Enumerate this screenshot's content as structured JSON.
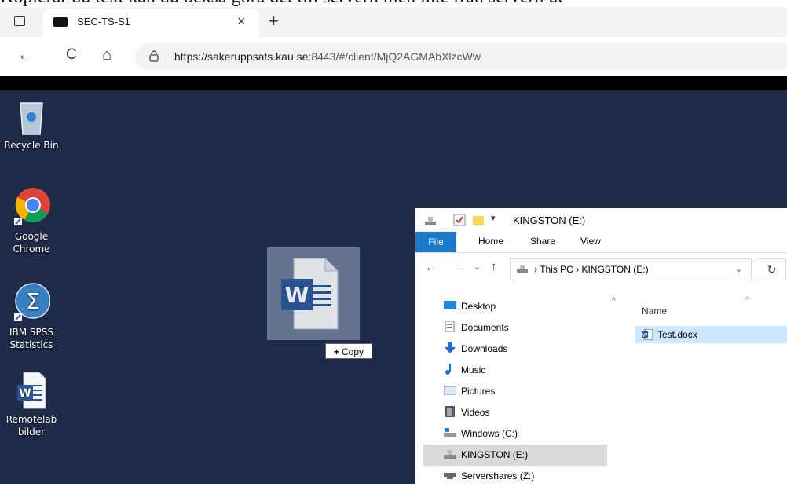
{
  "document_text": "Kopierar du text kan du också göra det till servern men inte från servern ut",
  "browser": {
    "tab_title": "SEC-TS-S1",
    "tab_close": "×",
    "new_tab": "+",
    "url_host": "https://sakeruppsats.kau.se",
    "url_rest": ":8443/#/client/MjQ2AGMAbXlzcWw",
    "back_icon": "←",
    "reload_icon": "C",
    "home_icon": "⌂"
  },
  "desktop": {
    "icons": [
      {
        "label_lines": [
          "Recycle Bin"
        ]
      },
      {
        "label_lines": [
          "Google",
          "Chrome"
        ]
      },
      {
        "label_lines": [
          "IBM SPSS",
          "Statistics"
        ]
      },
      {
        "label_lines": [
          "Remotelab",
          "bilder"
        ]
      }
    ],
    "drag_badge": "W",
    "copy_tooltip": "Copy",
    "copy_plus": "+"
  },
  "explorer": {
    "title": "KINGSTON (E:)",
    "ribbon_tabs": [
      "File",
      "Home",
      "Share",
      "View"
    ],
    "address_path": "This PC  ›  KINGSTON (E:)",
    "nav_items": [
      {
        "label": "Desktop",
        "icon": "desktop-icon"
      },
      {
        "label": "Documents",
        "icon": "documents-icon"
      },
      {
        "label": "Downloads",
        "icon": "downloads-icon"
      },
      {
        "label": "Music",
        "icon": "music-icon"
      },
      {
        "label": "Pictures",
        "icon": "pictures-icon"
      },
      {
        "label": "Videos",
        "icon": "videos-icon"
      },
      {
        "label": "Windows (C:)",
        "icon": "drive-icon"
      },
      {
        "label": "KINGSTON (E:)",
        "icon": "usb-drive-icon",
        "selected": true
      },
      {
        "label": "Servershares (Z:)",
        "icon": "network-drive-icon"
      }
    ],
    "column_header": "Name",
    "files": [
      {
        "name": "Test.docx",
        "icon": "word-doc-icon",
        "selected": true
      }
    ]
  },
  "colors": {
    "desktop_bg": "#1e2a48",
    "file_tab": "#1979ca",
    "selection": "#cce8ff"
  }
}
